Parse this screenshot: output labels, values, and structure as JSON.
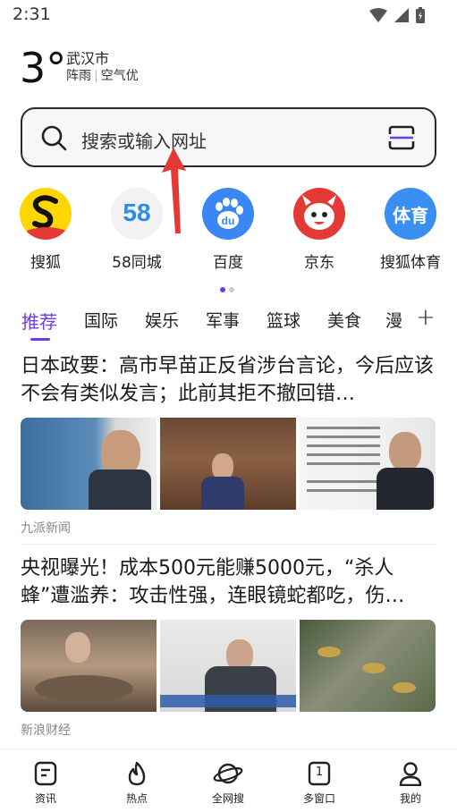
{
  "status": {
    "time": "2:31"
  },
  "weather": {
    "temp": "3°",
    "city": "武汉市",
    "condition": "阵雨",
    "air": "空气优"
  },
  "search": {
    "placeholder": "搜索或输入网址"
  },
  "shortcuts": [
    {
      "label": "搜狐",
      "icon": "sohu-icon"
    },
    {
      "label": "58同城",
      "icon": "58-icon"
    },
    {
      "label": "百度",
      "icon": "baidu-icon"
    },
    {
      "label": "京东",
      "icon": "jd-icon"
    },
    {
      "label": "搜狐体育",
      "icon": "sohu-sports-icon",
      "icon_text": "体育"
    }
  ],
  "logo_58": "58",
  "logo_baidu": "du",
  "tabs": [
    "推荐",
    "国际",
    "娱乐",
    "军事",
    "篮球",
    "美食",
    "漫"
  ],
  "articles": [
    {
      "title": "日本政要：高市早苗正反省涉台言论，今后应该不会有类似发言；此前其拒不撤回错…",
      "source": "九派新闻"
    },
    {
      "title": "央视曝光！成本500元能赚5000元，“杀人蜂”遭滥养：攻击性强，连眼镜蛇都吃，伤…",
      "source": "新浪财经"
    }
  ],
  "bottom_nav": [
    {
      "label": "资讯",
      "icon": "news-icon"
    },
    {
      "label": "热点",
      "icon": "flame-icon"
    },
    {
      "label": "全网搜",
      "icon": "planet-icon"
    },
    {
      "label": "多窗口",
      "icon": "windows-icon",
      "count": "1"
    },
    {
      "label": "我的",
      "icon": "user-icon"
    }
  ],
  "colors": {
    "accent": "#6c3cf0",
    "arrow": "#e53935"
  }
}
